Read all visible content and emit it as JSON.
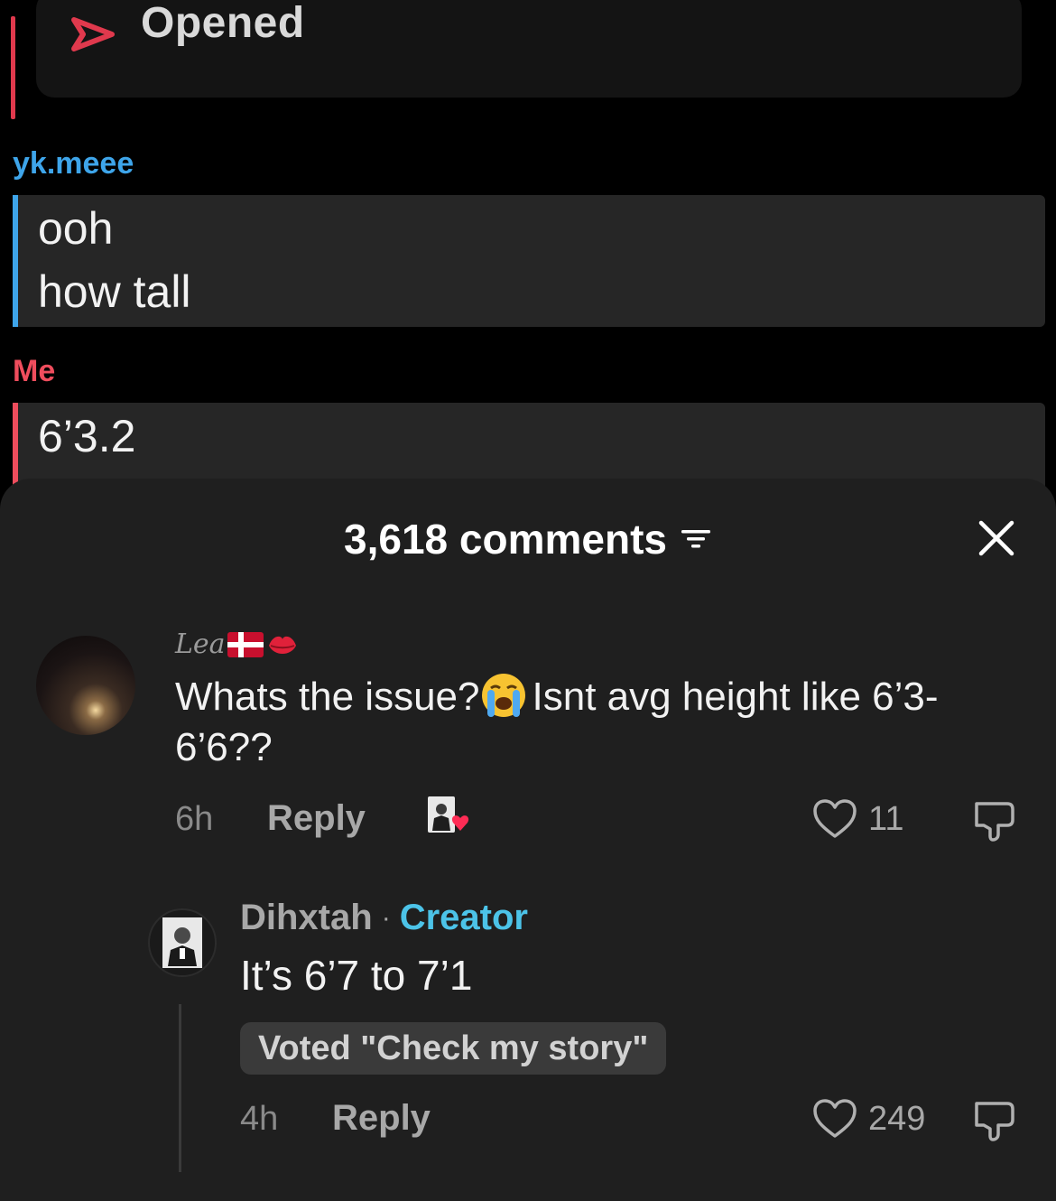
{
  "chat": {
    "status_label": "Opened",
    "accent_color": "#e0394d",
    "messages": [
      {
        "sender": "yk.meee",
        "lines": [
          "ooh",
          "how tall"
        ],
        "color": "#3ea5ea"
      },
      {
        "sender": "Me",
        "lines": [
          "6’3.2"
        ],
        "color": "#ef4d5d"
      }
    ]
  },
  "comments_sheet": {
    "title": "3,618 comments",
    "icons": {
      "filter": "filter-icon",
      "close": "close-icon"
    },
    "comments": [
      {
        "username": "Lea",
        "username_icons": [
          "denmark-flag-icon",
          "kiss-lips-icon"
        ],
        "text_part1": "Whats the issue?",
        "emoji": "loudly-crying-face-icon",
        "text_part2": "Isnt avg height like 6’3-6’6??",
        "time": "6h",
        "reply_label": "Reply",
        "liked_by_creator": true,
        "likes": "11"
      },
      {
        "username": "Dihxtah",
        "separator": "·",
        "badge": "Creator",
        "badge_color": "#4cc3e8",
        "text": "It’s 6’7 to 7’1",
        "vote_label": "Voted \"Check my story\"",
        "time": "4h",
        "reply_label": "Reply",
        "likes": "249"
      }
    ]
  }
}
